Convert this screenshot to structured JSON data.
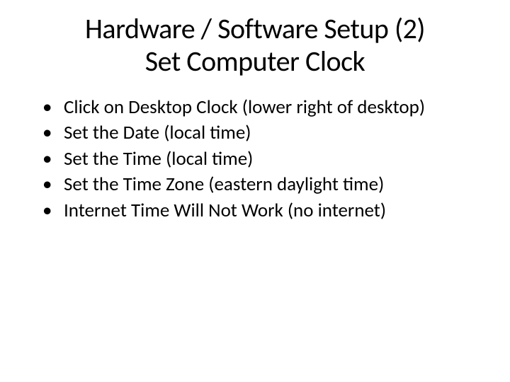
{
  "title_line1": "Hardware / Software Setup (2)",
  "title_line2": "Set Computer Clock",
  "bullets": [
    "Click on Desktop Clock (lower right of desktop)",
    "Set the Date (local time)",
    "Set the Time (local time)",
    "Set the Time Zone (eastern daylight time)",
    "Internet Time Will Not Work (no internet)"
  ]
}
